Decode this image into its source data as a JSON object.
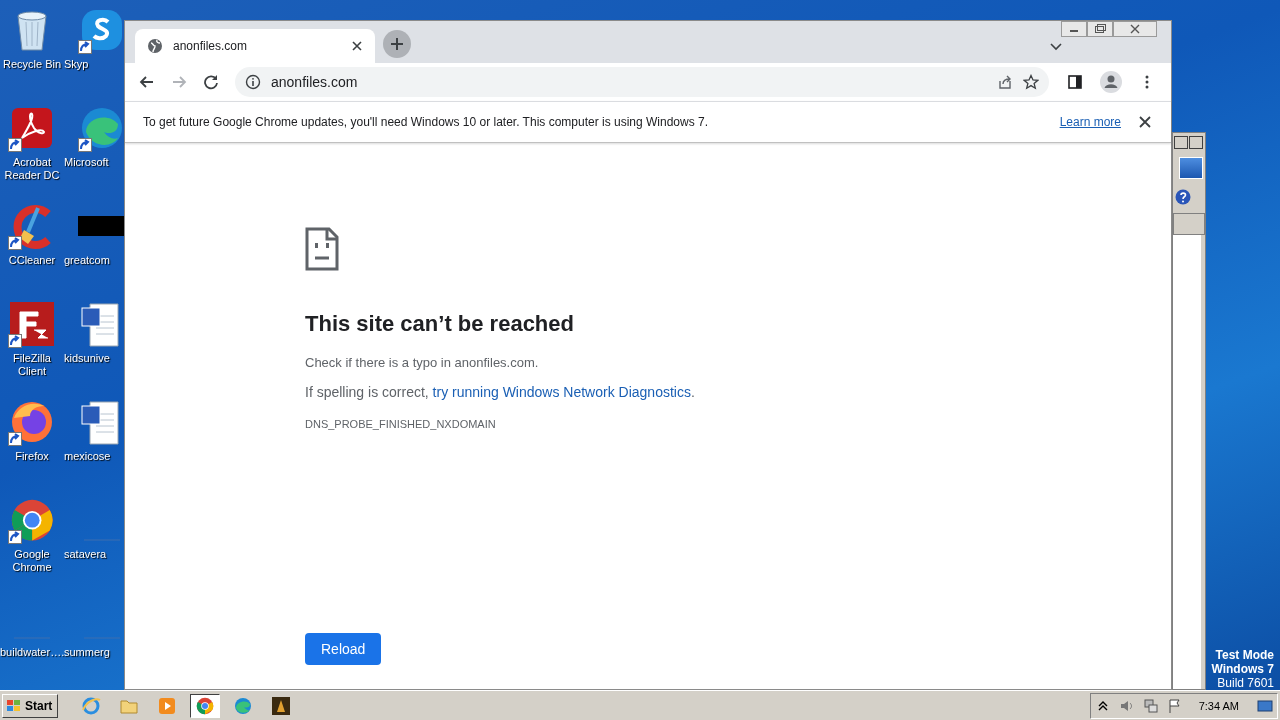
{
  "desktop": {
    "columns": [
      [
        {
          "label": "Recycle Bin",
          "kind": "recycle",
          "shortcut": false
        },
        {
          "label": "Acrobat Reader DC",
          "kind": "acrobat",
          "shortcut": true
        },
        {
          "label": "CCleaner",
          "kind": "ccleaner",
          "shortcut": true
        },
        {
          "label": "FileZilla Client",
          "kind": "filezilla",
          "shortcut": true
        },
        {
          "label": "Firefox",
          "kind": "firefox",
          "shortcut": true
        },
        {
          "label": "Google Chrome",
          "kind": "chrome",
          "shortcut": true
        },
        {
          "label": "buildwater….",
          "kind": "blank",
          "shortcut": false
        }
      ],
      [
        {
          "label": "Skyp",
          "kind": "skype",
          "shortcut": true
        },
        {
          "label": "Microsoft",
          "kind": "edge",
          "shortcut": true
        },
        {
          "label": "greatcom",
          "kind": "black",
          "shortcut": false
        },
        {
          "label": "kidsunive",
          "kind": "word",
          "shortcut": false
        },
        {
          "label": "mexicose",
          "kind": "word",
          "shortcut": false
        },
        {
          "label": "satavera",
          "kind": "blank",
          "shortcut": false
        },
        {
          "label": "summerg",
          "kind": "blank",
          "shortcut": false
        }
      ]
    ],
    "test_mode": [
      "Test Mode",
      "Windows 7",
      "Build 7601"
    ]
  },
  "browser": {
    "tabs": [
      {
        "title": "anonfiles.com",
        "selected": true
      }
    ],
    "nav": [
      {
        "kind": "back",
        "disabled": false
      },
      {
        "kind": "forward",
        "disabled": true
      },
      {
        "kind": "reload",
        "disabled": false
      }
    ],
    "address": "anonfiles.com",
    "infobar": {
      "message": "To get future Google Chrome updates, you'll need Windows 10 or later. This computer is using Windows 7.",
      "link": "Learn more"
    },
    "error_page": {
      "heading": "This site can’t be reached",
      "check": "Check if there is a typo in anonfiles.com.",
      "suggestion_prefix": "If spelling is correct, ",
      "suggestion_link": "try running Windows Network Diagnostics",
      "suggestion_suffix": ".",
      "code": "DNS_PROBE_FINISHED_NXDOMAIN",
      "button": "Reload"
    }
  },
  "taskbar": {
    "start": "Start",
    "apps": [
      {
        "kind": "ie",
        "selected": false
      },
      {
        "kind": "folder",
        "selected": false
      },
      {
        "kind": "media",
        "selected": false
      },
      {
        "kind": "chrome",
        "selected": true
      },
      {
        "kind": "edge",
        "selected": false
      },
      {
        "kind": "app",
        "selected": false
      }
    ],
    "clock": "7:34 AM"
  }
}
